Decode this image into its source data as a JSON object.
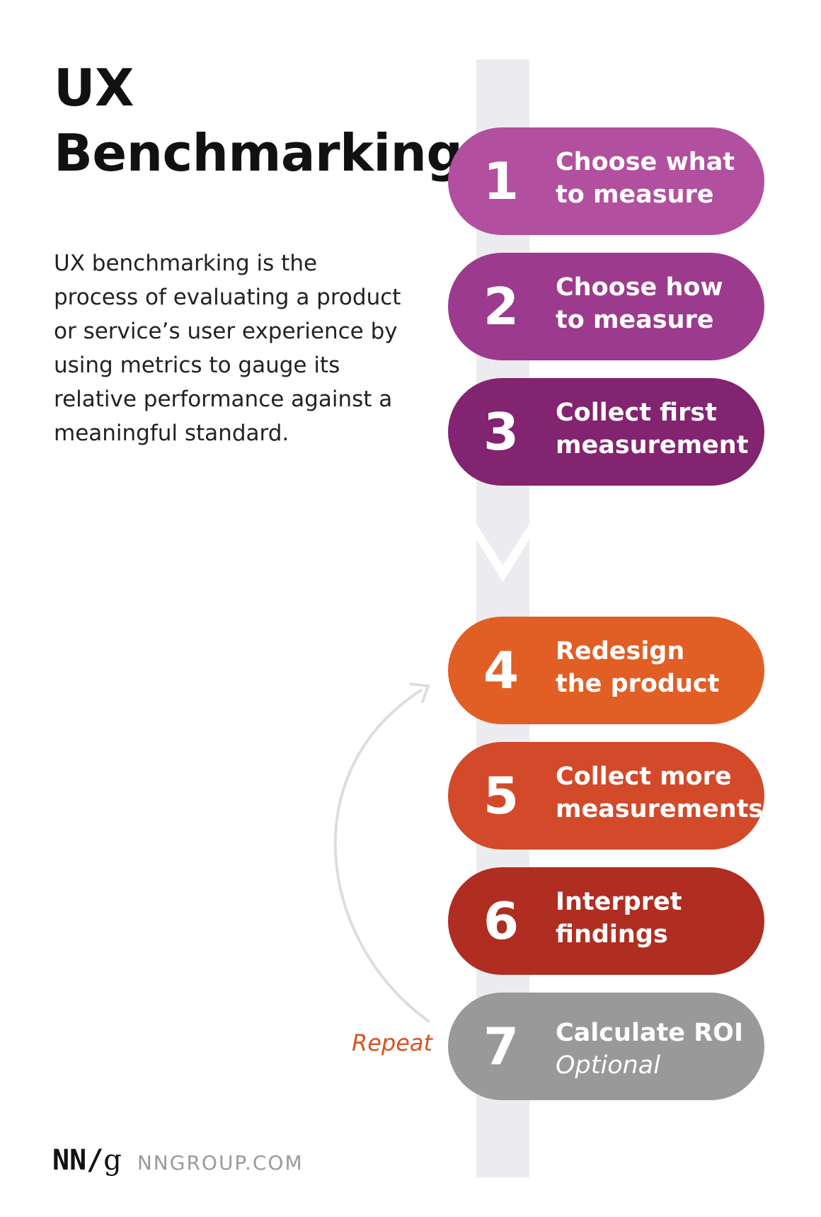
{
  "header": {
    "title_line1": "UX",
    "title_line2": "Benchmarking",
    "description": "UX benchmarking is the process of evaluating a product or service’s user experience by using metrics to gauge its relative performance against a meaningful standard."
  },
  "steps": [
    {
      "number": "1",
      "line1": "Choose what",
      "line2": "to measure",
      "color": "#b24f9f"
    },
    {
      "number": "2",
      "line1": "Choose how",
      "line2": "to measure",
      "color": "#9c3b8d"
    },
    {
      "number": "3",
      "line1": "Collect first",
      "line2": "measurement",
      "color": "#82246f"
    },
    {
      "number": "4",
      "line1": "Redesign",
      "line2": "the product",
      "color": "#e15e25"
    },
    {
      "number": "5",
      "line1": "Collect more",
      "line2": "measurements",
      "color": "#d24a2a"
    },
    {
      "number": "6",
      "line1": "Interpret",
      "line2": "findings",
      "color": "#b02d22"
    },
    {
      "number": "7",
      "line1": "Calculate ROI",
      "line2": "Optional",
      "color": "#999999"
    }
  ],
  "repeat_label": "Repeat",
  "footer": {
    "logo_text": "NN/",
    "logo_g": "g",
    "site": "NNGROUP.COM"
  },
  "colors": {
    "track": "#ecebef",
    "repeat": "#d9531e",
    "loop_arrow": "#dddddd"
  }
}
